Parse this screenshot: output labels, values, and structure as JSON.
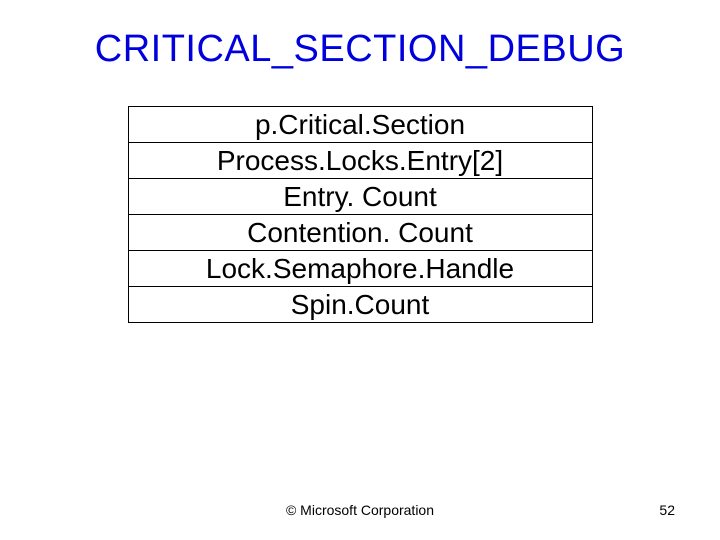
{
  "title": "CRITICAL_SECTION_DEBUG",
  "rows": [
    "p.Critical.Section",
    "Process.Locks.Entry[2]",
    "Entry. Count",
    "Contention. Count",
    "Lock.Semaphore.Handle",
    "Spin.Count"
  ],
  "footer": {
    "copyright": "© Microsoft Corporation",
    "page": "52"
  }
}
